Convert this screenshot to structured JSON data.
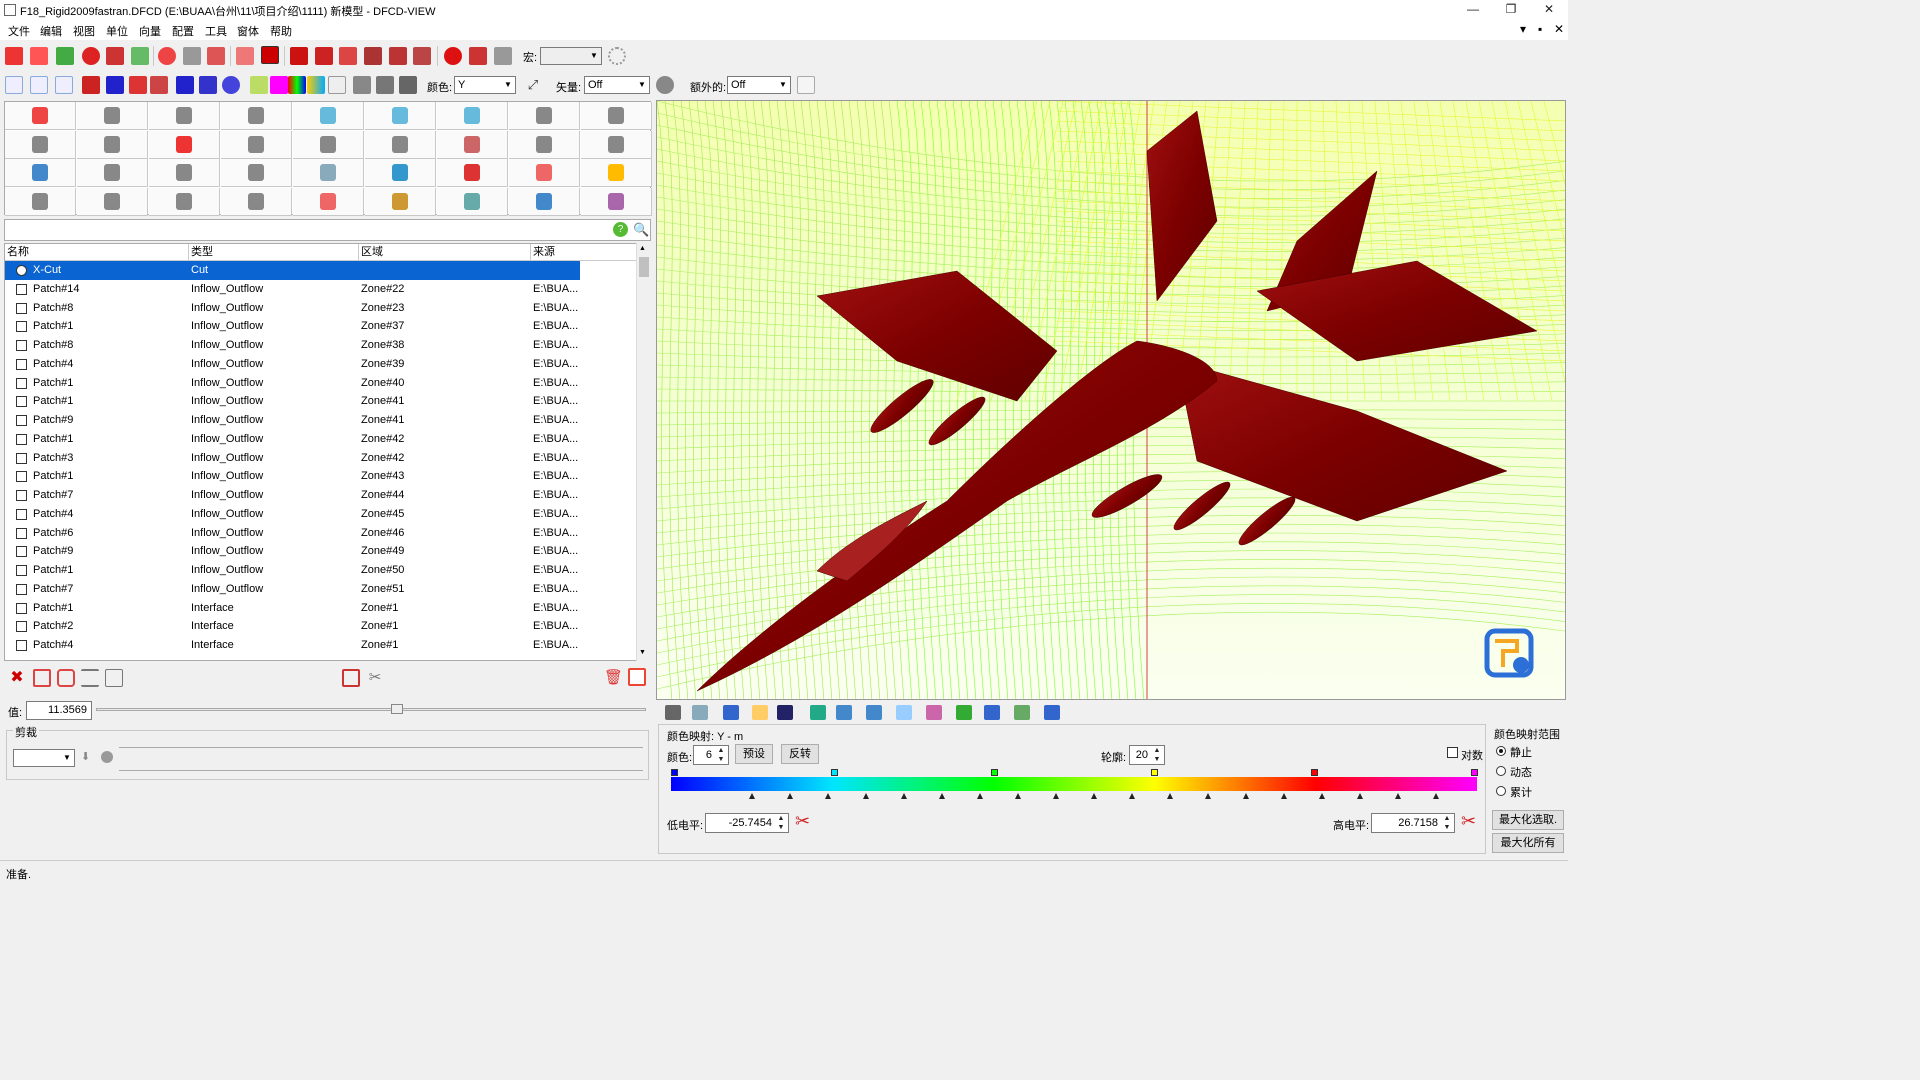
{
  "window": {
    "title": "F18_Rigid2009fastran.DFCD (E:\\BUAA\\台州\\11\\项目介绍\\1111) 新模型 - DFCD-VIEW",
    "minimize": "—",
    "restore": "❐",
    "close": "✕"
  },
  "menu": {
    "items": [
      "文件",
      "编辑",
      "视图",
      "单位",
      "向量",
      "配置",
      "工具",
      "窗体",
      "帮助"
    ],
    "mdi_controls": [
      "▾",
      "▪",
      "✕"
    ]
  },
  "toolbar1": {
    "macro_label": "宏:",
    "macro_value": ""
  },
  "toolbar2": {
    "color_label": "颜色:",
    "color_value": "Y",
    "vector_label": "矢量:",
    "vector_value": "Off",
    "extra_label": "额外的:",
    "extra_value": "Off"
  },
  "table": {
    "headers": [
      "名称",
      "类型",
      "区域",
      "来源"
    ],
    "rows": [
      {
        "name": "X-Cut",
        "type": "Cut",
        "zone": "",
        "source": ""
      },
      {
        "name": "Patch#14",
        "type": "Inflow_Outflow",
        "zone": "Zone#22",
        "source": "E:\\BUA..."
      },
      {
        "name": "Patch#8",
        "type": "Inflow_Outflow",
        "zone": "Zone#23",
        "source": "E:\\BUA..."
      },
      {
        "name": "Patch#1",
        "type": "Inflow_Outflow",
        "zone": "Zone#37",
        "source": "E:\\BUA..."
      },
      {
        "name": "Patch#8",
        "type": "Inflow_Outflow",
        "zone": "Zone#38",
        "source": "E:\\BUA..."
      },
      {
        "name": "Patch#4",
        "type": "Inflow_Outflow",
        "zone": "Zone#39",
        "source": "E:\\BUA..."
      },
      {
        "name": "Patch#1",
        "type": "Inflow_Outflow",
        "zone": "Zone#40",
        "source": "E:\\BUA..."
      },
      {
        "name": "Patch#1",
        "type": "Inflow_Outflow",
        "zone": "Zone#41",
        "source": "E:\\BUA..."
      },
      {
        "name": "Patch#9",
        "type": "Inflow_Outflow",
        "zone": "Zone#41",
        "source": "E:\\BUA..."
      },
      {
        "name": "Patch#1",
        "type": "Inflow_Outflow",
        "zone": "Zone#42",
        "source": "E:\\BUA..."
      },
      {
        "name": "Patch#3",
        "type": "Inflow_Outflow",
        "zone": "Zone#42",
        "source": "E:\\BUA..."
      },
      {
        "name": "Patch#1",
        "type": "Inflow_Outflow",
        "zone": "Zone#43",
        "source": "E:\\BUA..."
      },
      {
        "name": "Patch#7",
        "type": "Inflow_Outflow",
        "zone": "Zone#44",
        "source": "E:\\BUA..."
      },
      {
        "name": "Patch#4",
        "type": "Inflow_Outflow",
        "zone": "Zone#45",
        "source": "E:\\BUA..."
      },
      {
        "name": "Patch#6",
        "type": "Inflow_Outflow",
        "zone": "Zone#46",
        "source": "E:\\BUA..."
      },
      {
        "name": "Patch#9",
        "type": "Inflow_Outflow",
        "zone": "Zone#49",
        "source": "E:\\BUA..."
      },
      {
        "name": "Patch#1",
        "type": "Inflow_Outflow",
        "zone": "Zone#50",
        "source": "E:\\BUA..."
      },
      {
        "name": "Patch#7",
        "type": "Inflow_Outflow",
        "zone": "Zone#51",
        "source": "E:\\BUA..."
      },
      {
        "name": "Patch#1",
        "type": "Interface",
        "zone": "Zone#1",
        "source": "E:\\BUA..."
      },
      {
        "name": "Patch#2",
        "type": "Interface",
        "zone": "Zone#1",
        "source": "E:\\BUA..."
      },
      {
        "name": "Patch#4",
        "type": "Interface",
        "zone": "Zone#1",
        "source": "E:\\BUA..."
      }
    ]
  },
  "value_row": {
    "label": "值:",
    "value": "11.3569"
  },
  "clip": {
    "group_label": "剪裁"
  },
  "status": {
    "text": "准备."
  },
  "colormap": {
    "title": "颜色映射:  Y - m",
    "colors_label": "颜色:",
    "colors_value": "6",
    "preset_button": "预设",
    "reverse_button": "反转",
    "contour_label": "轮廓:",
    "contour_value": "20",
    "log_label": "对数",
    "low_label": "低电平:",
    "low_value": "-25.7454",
    "high_label": "高电平:",
    "high_value": "26.7158",
    "gradient_stops": [
      "#0000ff",
      "#00e5ff",
      "#00ff00",
      "#ffff00",
      "#ff0000",
      "#ff00ff"
    ]
  },
  "range": {
    "title": "颜色映射范围",
    "options": [
      "静止",
      "动态",
      "累计"
    ],
    "selected": "静止",
    "max_selection_button": "最大化选取.",
    "max_all_button": "最大化所有"
  },
  "viewport": {
    "mesh_color": "#7aff2a",
    "body_color": "#8b0000"
  }
}
